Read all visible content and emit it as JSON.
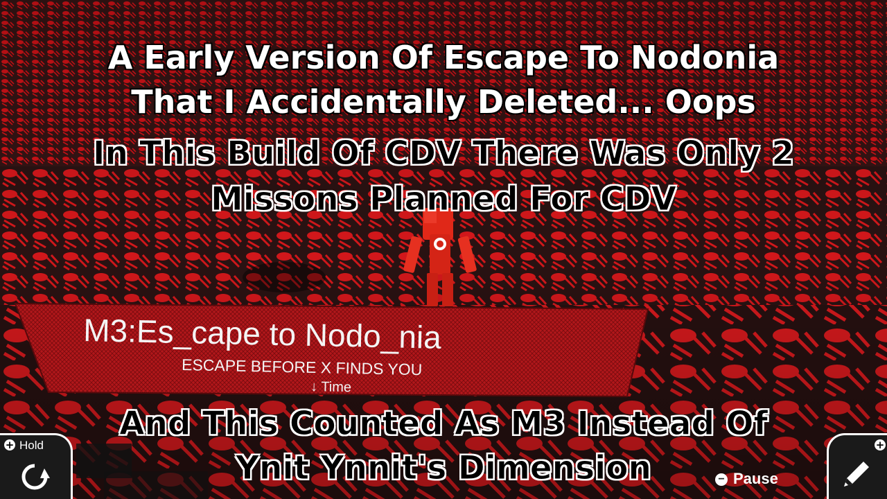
{
  "captions": {
    "line1": "A Early Version Of Escape To Nodonia",
    "line2": "That I Accidentally Deleted... Oops",
    "line3": "In This Build Of CDV There Was Only 2",
    "line4": "Missons Planned For CDV",
    "line5": "And This Counted As M3 Instead Of",
    "line6": "Ynit Ynnit's Dimension"
  },
  "mission_board": {
    "title": "M3:Es_cape to Nodo_nia",
    "subtitle": "ESCAPE BEFORE X FINDS YOU",
    "stat_label": "↓ Time"
  },
  "hud": {
    "hold_label": "Hold",
    "pause_label": "Pause",
    "hold_icon": "rotate-icon",
    "pencil_icon": "pencil-icon"
  },
  "colors": {
    "floor_red": "#e8141a",
    "floor_dark": "#2a1414",
    "robot_red": "#e02818"
  }
}
